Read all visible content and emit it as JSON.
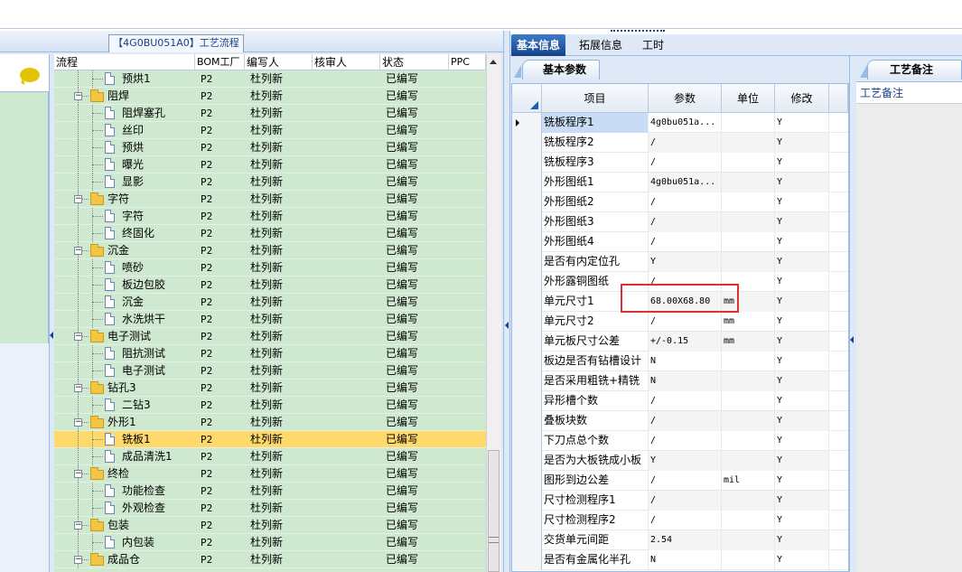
{
  "left": {
    "title": "【4G0BU051A0】工艺流程",
    "columns": [
      "流程",
      "BOM工厂",
      "编写人",
      "核审人",
      "状态",
      "PPC"
    ],
    "rows": [
      {
        "level": 2,
        "kind": "doc",
        "name": "预烘1",
        "factory": "P2",
        "writer": "杜列新",
        "reviewer": "",
        "status": "已编写"
      },
      {
        "level": 1,
        "kind": "folder",
        "name": "阻焊",
        "factory": "P2",
        "writer": "杜列新",
        "reviewer": "",
        "status": "已编写"
      },
      {
        "level": 2,
        "kind": "doc",
        "name": "阻焊塞孔",
        "factory": "P2",
        "writer": "杜列新",
        "reviewer": "",
        "status": "已编写"
      },
      {
        "level": 2,
        "kind": "doc",
        "name": "丝印",
        "factory": "P2",
        "writer": "杜列新",
        "reviewer": "",
        "status": "已编写"
      },
      {
        "level": 2,
        "kind": "doc",
        "name": "预烘",
        "factory": "P2",
        "writer": "杜列新",
        "reviewer": "",
        "status": "已编写"
      },
      {
        "level": 2,
        "kind": "doc",
        "name": "曝光",
        "factory": "P2",
        "writer": "杜列新",
        "reviewer": "",
        "status": "已编写"
      },
      {
        "level": 2,
        "kind": "doc",
        "name": "显影",
        "factory": "P2",
        "writer": "杜列新",
        "reviewer": "",
        "status": "已编写"
      },
      {
        "level": 1,
        "kind": "folder",
        "name": "字符",
        "factory": "P2",
        "writer": "杜列新",
        "reviewer": "",
        "status": "已编写"
      },
      {
        "level": 2,
        "kind": "doc",
        "name": "字符",
        "factory": "P2",
        "writer": "杜列新",
        "reviewer": "",
        "status": "已编写"
      },
      {
        "level": 2,
        "kind": "doc",
        "name": "终固化",
        "factory": "P2",
        "writer": "杜列新",
        "reviewer": "",
        "status": "已编写"
      },
      {
        "level": 1,
        "kind": "folder",
        "name": "沉金",
        "factory": "P2",
        "writer": "杜列新",
        "reviewer": "",
        "status": "已编写"
      },
      {
        "level": 2,
        "kind": "doc",
        "name": "喷砂",
        "factory": "P2",
        "writer": "杜列新",
        "reviewer": "",
        "status": "已编写"
      },
      {
        "level": 2,
        "kind": "doc",
        "name": "板边包胶",
        "factory": "P2",
        "writer": "杜列新",
        "reviewer": "",
        "status": "已编写"
      },
      {
        "level": 2,
        "kind": "doc",
        "name": "沉金",
        "factory": "P2",
        "writer": "杜列新",
        "reviewer": "",
        "status": "已编写"
      },
      {
        "level": 2,
        "kind": "doc",
        "name": "水洗烘干",
        "factory": "P2",
        "writer": "杜列新",
        "reviewer": "",
        "status": "已编写"
      },
      {
        "level": 1,
        "kind": "folder",
        "name": "电子测试",
        "factory": "P2",
        "writer": "杜列新",
        "reviewer": "",
        "status": "已编写"
      },
      {
        "level": 2,
        "kind": "doc",
        "name": "阻抗测试",
        "factory": "P2",
        "writer": "杜列新",
        "reviewer": "",
        "status": "已编写"
      },
      {
        "level": 2,
        "kind": "doc",
        "name": "电子测试",
        "factory": "P2",
        "writer": "杜列新",
        "reviewer": "",
        "status": "已编写"
      },
      {
        "level": 1,
        "kind": "folder",
        "name": "钻孔3",
        "factory": "P2",
        "writer": "杜列新",
        "reviewer": "",
        "status": "已编写"
      },
      {
        "level": 2,
        "kind": "doc",
        "name": "二钻3",
        "factory": "P2",
        "writer": "杜列新",
        "reviewer": "",
        "status": "已编写"
      },
      {
        "level": 1,
        "kind": "folder",
        "name": "外形1",
        "factory": "P2",
        "writer": "杜列新",
        "reviewer": "",
        "status": "已编写"
      },
      {
        "level": 2,
        "kind": "doc",
        "name": "铣板1",
        "factory": "P2",
        "writer": "杜列新",
        "reviewer": "",
        "status": "已编写",
        "selected": true
      },
      {
        "level": 2,
        "kind": "doc",
        "name": "成品清洗1",
        "factory": "P2",
        "writer": "杜列新",
        "reviewer": "",
        "status": "已编写"
      },
      {
        "level": 1,
        "kind": "folder",
        "name": "终检",
        "factory": "P2",
        "writer": "杜列新",
        "reviewer": "",
        "status": "已编写"
      },
      {
        "level": 2,
        "kind": "doc",
        "name": "功能检查",
        "factory": "P2",
        "writer": "杜列新",
        "reviewer": "",
        "status": "已编写"
      },
      {
        "level": 2,
        "kind": "doc",
        "name": "外观检查",
        "factory": "P2",
        "writer": "杜列新",
        "reviewer": "",
        "status": "已编写"
      },
      {
        "level": 1,
        "kind": "folder",
        "name": "包装",
        "factory": "P2",
        "writer": "杜列新",
        "reviewer": "",
        "status": "已编写"
      },
      {
        "level": 2,
        "kind": "doc",
        "name": "内包装",
        "factory": "P2",
        "writer": "杜列新",
        "reviewer": "",
        "status": "已编写"
      },
      {
        "level": 1,
        "kind": "folder",
        "name": "成品仓",
        "factory": "P2",
        "writer": "杜列新",
        "reviewer": "",
        "status": "已编写"
      }
    ]
  },
  "right": {
    "tabs": [
      "基本信息",
      "拓展信息",
      "工时"
    ],
    "active_tab": 0,
    "param_tab": "基本参数",
    "columns": [
      "项目",
      "参数",
      "单位",
      "修改"
    ],
    "rows": [
      {
        "item": "铣板程序1",
        "value": "4g0bu051a...",
        "unit": "",
        "edit": "Y",
        "current": true
      },
      {
        "item": "铣板程序2",
        "value": "/",
        "unit": "",
        "edit": "Y"
      },
      {
        "item": "铣板程序3",
        "value": "/",
        "unit": "",
        "edit": "Y"
      },
      {
        "item": "外形图纸1",
        "value": "4g0bu051a...",
        "unit": "",
        "edit": "Y"
      },
      {
        "item": "外形图纸2",
        "value": "/",
        "unit": "",
        "edit": "Y"
      },
      {
        "item": "外形图纸3",
        "value": "/",
        "unit": "",
        "edit": "Y"
      },
      {
        "item": "外形图纸4",
        "value": "/",
        "unit": "",
        "edit": "Y"
      },
      {
        "item": "是否有内定位孔",
        "value": "Y",
        "unit": "",
        "edit": "Y"
      },
      {
        "item": "外形露铜图纸",
        "value": "/",
        "unit": "",
        "edit": "Y"
      },
      {
        "item": "单元尺寸1",
        "value": "68.00X68.80",
        "unit": "mm",
        "edit": "Y"
      },
      {
        "item": "单元尺寸2",
        "value": "/",
        "unit": "mm",
        "edit": "Y"
      },
      {
        "item": "单元板尺寸公差",
        "value": "+/-0.15",
        "unit": "mm",
        "edit": "Y"
      },
      {
        "item": "板边是否有钻槽设计",
        "value": "N",
        "unit": "",
        "edit": "Y"
      },
      {
        "item": "是否采用粗铣+精铣",
        "value": "N",
        "unit": "",
        "edit": "Y"
      },
      {
        "item": "异形槽个数",
        "value": "/",
        "unit": "",
        "edit": "Y"
      },
      {
        "item": "叠板块数",
        "value": "/",
        "unit": "",
        "edit": "Y"
      },
      {
        "item": "下刀点总个数",
        "value": "/",
        "unit": "",
        "edit": "Y"
      },
      {
        "item": "是否为大板铣成小板",
        "value": "Y",
        "unit": "",
        "edit": "Y"
      },
      {
        "item": "图形到边公差",
        "value": "/",
        "unit": "mil",
        "edit": "Y"
      },
      {
        "item": "尺寸检测程序1",
        "value": "/",
        "unit": "",
        "edit": "Y"
      },
      {
        "item": "尺寸检测程序2",
        "value": "/",
        "unit": "",
        "edit": "Y"
      },
      {
        "item": "交货单元间距",
        "value": "2.54",
        "unit": "",
        "edit": "Y"
      },
      {
        "item": "是否有金属化半孔",
        "value": "N",
        "unit": "",
        "edit": "Y"
      }
    ]
  },
  "notes": {
    "tab": "工艺备注",
    "header": "工艺备注"
  },
  "colors": {
    "grid_bg": "#cfe8d0",
    "selected_row": "#ffd96a",
    "active_tab": "#15428b",
    "highlight_box": "#e03030"
  }
}
